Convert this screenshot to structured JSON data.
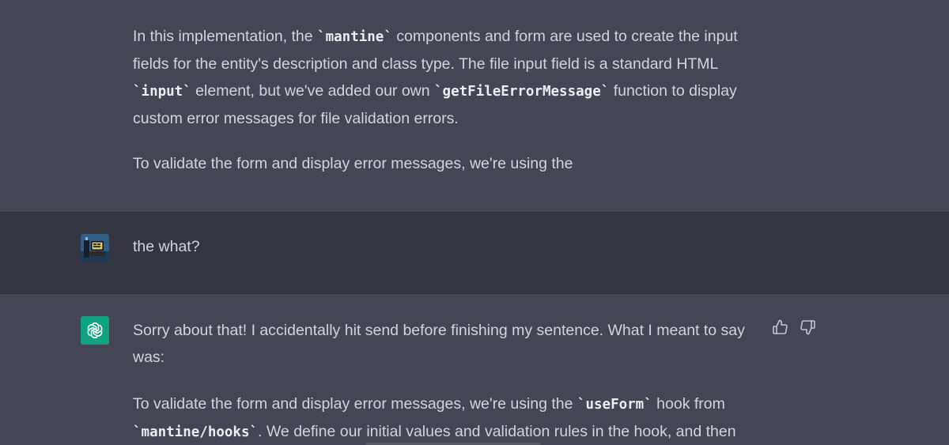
{
  "conversation": {
    "assistant_message_1": {
      "paragraph_1": {
        "line_1": {
          "pre": "In this implementation, the ",
          "code": "`mantine`",
          "post": " components and form are used to create the input"
        },
        "line_2": "fields for the entity's description and class type. The file input field is a standard HTML",
        "line_3": {
          "code1": "`input`",
          "mid": " element, but we've added our own ",
          "code2": "`getFileErrorMessage`",
          "post": " function to display"
        },
        "line_4": "custom error messages for file validation errors."
      },
      "paragraph_2": "To validate the form and display error messages, we're using the"
    },
    "user_message": {
      "text": "the what?",
      "avatar_icon": "user-avatar-image"
    },
    "assistant_message_2": {
      "avatar_icon": "openai-logo-icon",
      "paragraph_1": {
        "line_1": "Sorry about that! I accidentally hit send before finishing my sentence. What I meant to say",
        "line_2": "was:"
      },
      "paragraph_2": {
        "line_1": {
          "pre": "To validate the form and display error messages, we're using the ",
          "code": "`useForm`",
          "post": " hook from"
        },
        "line_2": {
          "code": "`mantine/hooks`",
          "post": ". We define our initial values and validation rules in the hook, and then"
        }
      },
      "feedback": {
        "thumbs_up_icon": "thumbs-up-icon",
        "thumbs_down_icon": "thumbs-down-icon"
      }
    }
  },
  "colors": {
    "assistant_bg": "#444654",
    "user_bg": "#343541",
    "text": "#d1d5db",
    "gpt_avatar": "#10a37f"
  }
}
